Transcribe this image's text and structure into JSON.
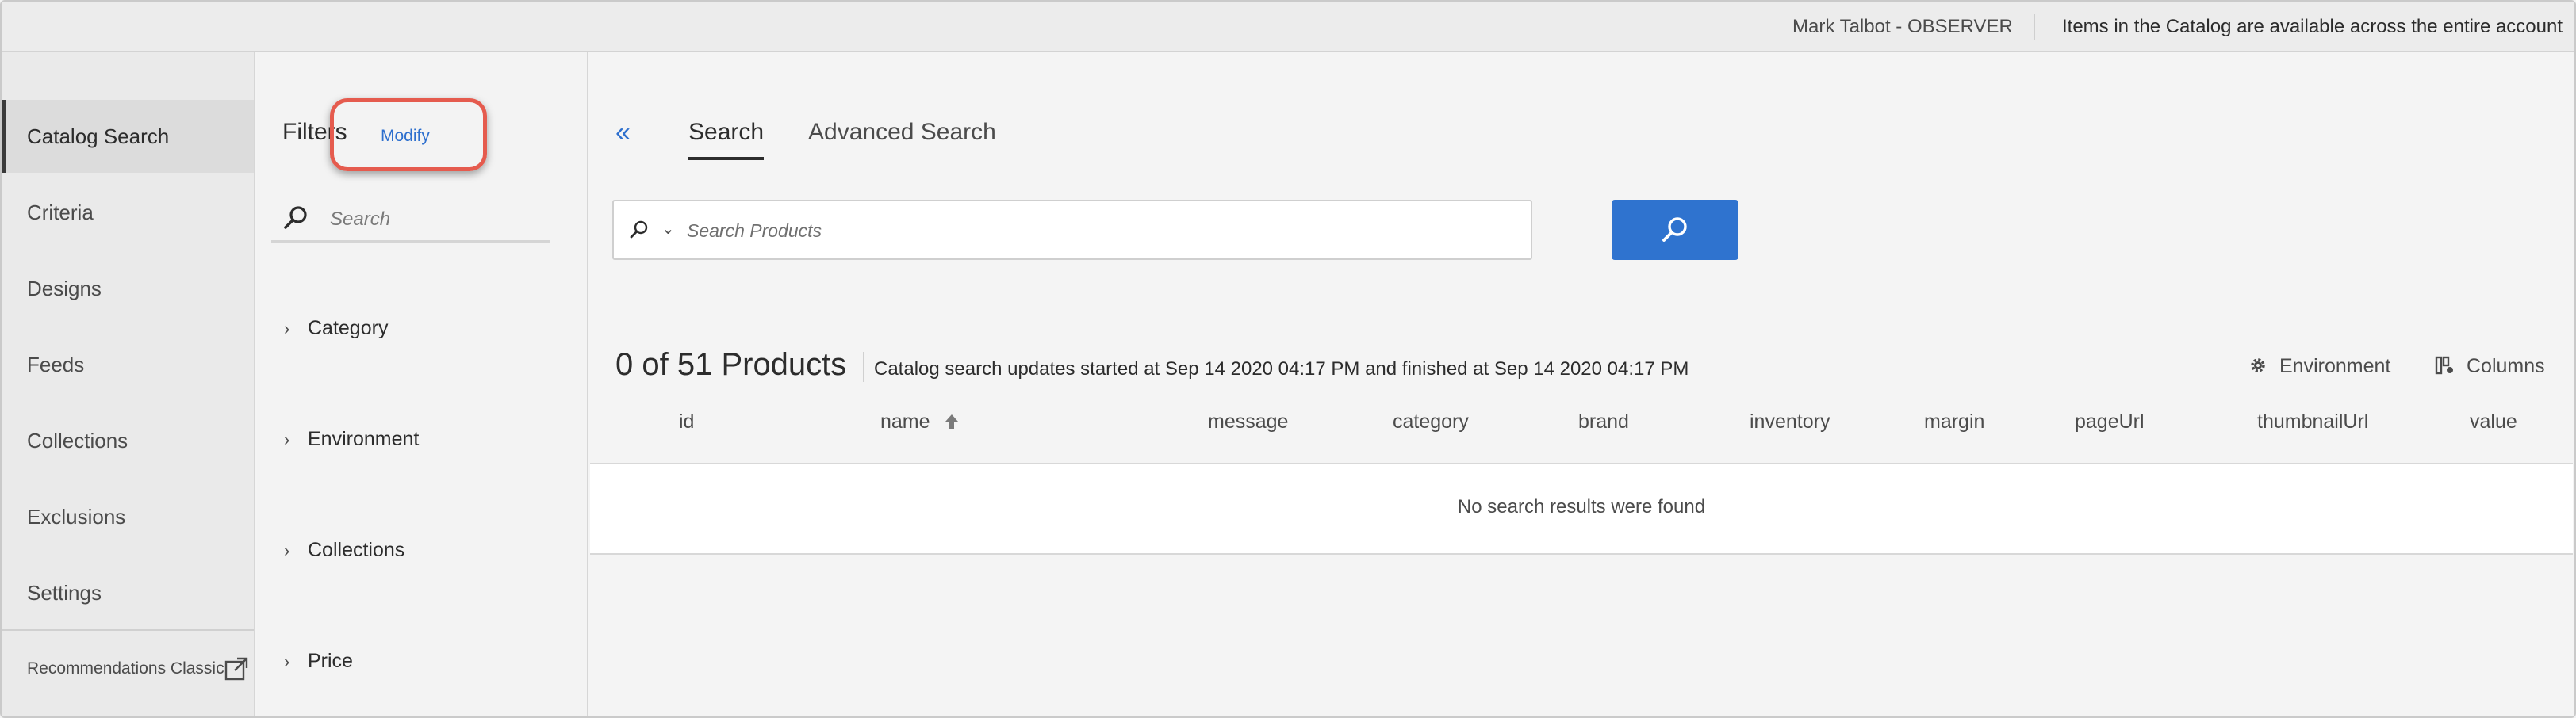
{
  "topbar": {
    "user": "Mark Talbot - OBSERVER",
    "notice": "Items in the Catalog are available across the entire account"
  },
  "nav": {
    "items": [
      {
        "label": "Catalog Search",
        "active": true
      },
      {
        "label": "Criteria"
      },
      {
        "label": "Designs"
      },
      {
        "label": "Feeds"
      },
      {
        "label": "Collections"
      },
      {
        "label": "Exclusions"
      },
      {
        "label": "Settings"
      }
    ],
    "classic_label": "Recommendations Classic",
    "classic_icon": "external-link-icon"
  },
  "filters": {
    "title": "Filters",
    "modify_label": "Modify",
    "search_placeholder": "Search",
    "facets": [
      "Category",
      "Environment",
      "Collections",
      "Price"
    ]
  },
  "main": {
    "tabs": [
      {
        "label": "Search",
        "active": true
      },
      {
        "label": "Advanced Search"
      }
    ],
    "search_placeholder": "Search Products",
    "result_count": "0 of 51 Products",
    "status": "Catalog search updates started at Sep 14 2020 04:17 PM and finished at Sep 14 2020 04:17 PM",
    "toolbar": {
      "environment_label": "Environment",
      "columns_label": "Columns"
    },
    "columns": [
      "id",
      "name",
      "message",
      "category",
      "brand",
      "inventory",
      "margin",
      "pageUrl",
      "thumbnailUrl",
      "value"
    ],
    "sorted_column": "name",
    "empty_message": "No search results were found"
  },
  "colors": {
    "accent": "#2f73cf",
    "highlight": "#e55b4e"
  }
}
